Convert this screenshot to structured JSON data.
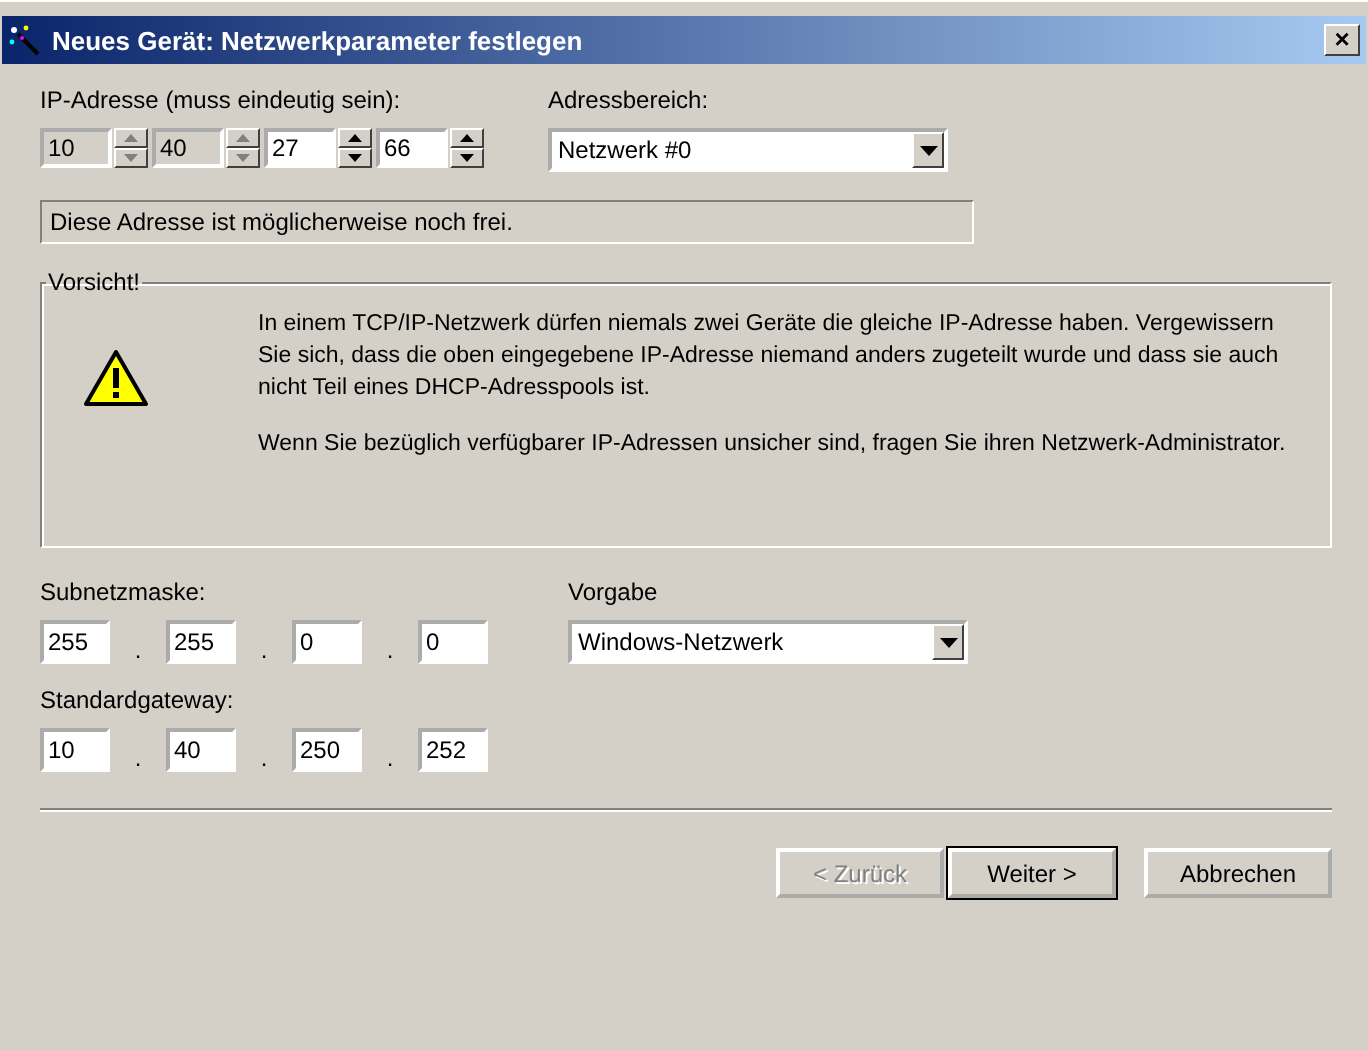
{
  "window": {
    "title": "Neues Gerät: Netzwerkparameter festlegen",
    "close": "×"
  },
  "ip_address": {
    "label": "IP-Adresse (muss eindeutig sein):",
    "octets": [
      {
        "value": "10",
        "disabled": true
      },
      {
        "value": "40",
        "disabled": true
      },
      {
        "value": "27",
        "disabled": false
      },
      {
        "value": "66",
        "disabled": false
      }
    ]
  },
  "address_range": {
    "label": "Adressbereich:",
    "value": "Netzwerk #0"
  },
  "status": "Diese Adresse ist möglicherweise noch frei.",
  "warning": {
    "title": "Vorsicht!",
    "paragraphs": [
      "In einem TCP/IP-Netzwerk dürfen niemals zwei Geräte die gleiche IP-Adresse haben. Vergewissern Sie sich, dass die oben eingegebene IP-Adresse niemand anders zugeteilt wurde und dass sie auch nicht Teil eines DHCP-Adresspools ist.",
      "Wenn Sie bezüglich verfügbarer IP-Adressen unsicher sind, fragen Sie ihren Netzwerk-Administrator."
    ]
  },
  "subnet_mask": {
    "label": "Subnetzmaske:",
    "separator": ".",
    "octets": [
      "255",
      "255",
      "0",
      "0"
    ]
  },
  "preset": {
    "label": "Vorgabe",
    "value": "Windows-Netzwerk"
  },
  "gateway": {
    "label": "Standardgateway:",
    "separator": ".",
    "octets": [
      "10",
      "40",
      "250",
      "252"
    ]
  },
  "buttons": [
    {
      "label": "< Zurück",
      "disabled": true,
      "default": false
    },
    {
      "label": "Weiter >",
      "disabled": false,
      "default": true
    },
    {
      "label": "Abbrechen",
      "disabled": false,
      "default": false
    }
  ]
}
